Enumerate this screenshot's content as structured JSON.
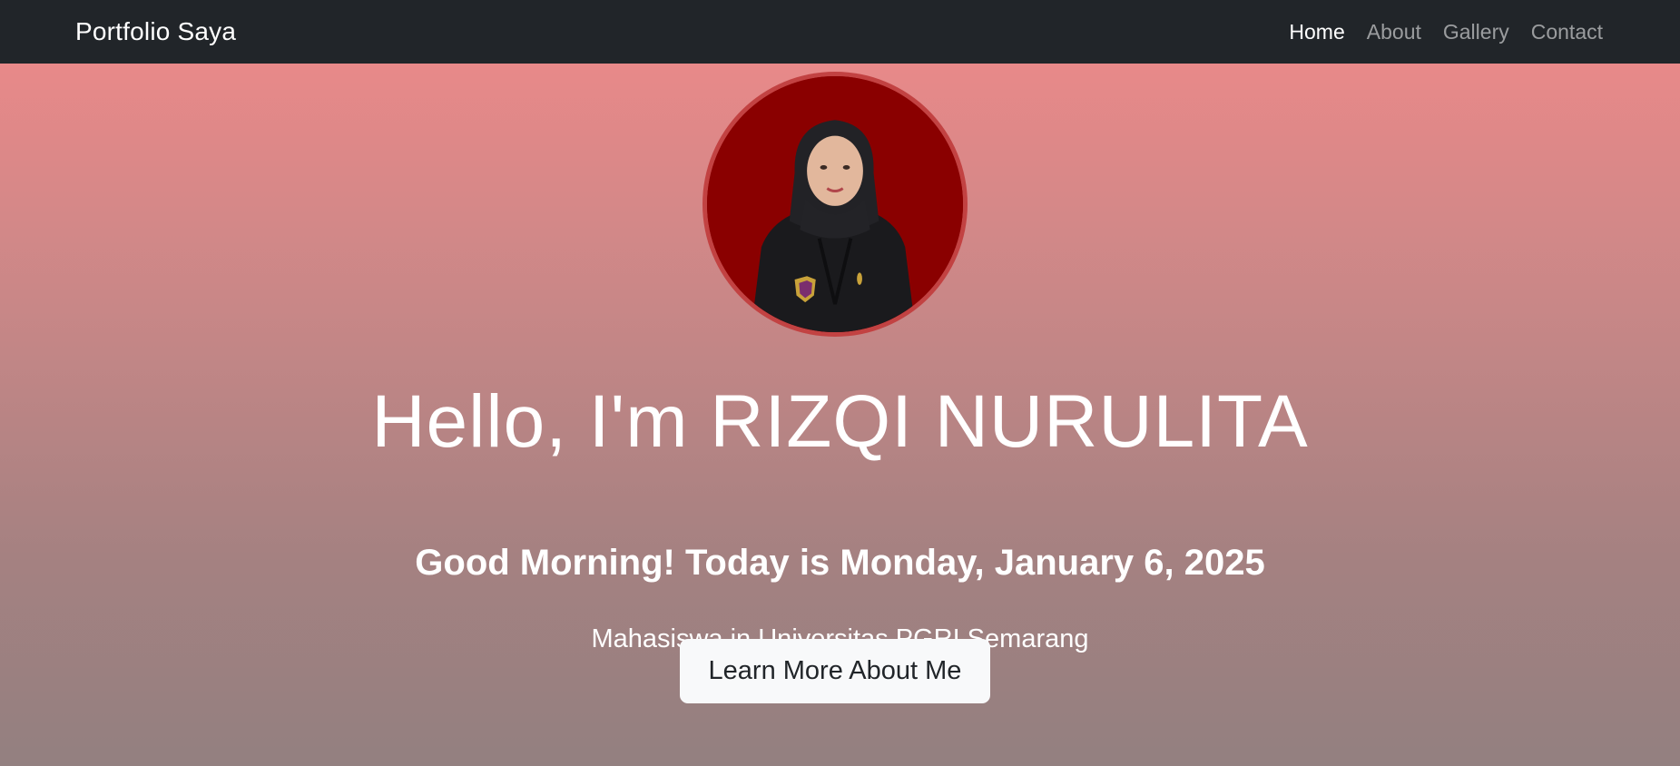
{
  "navbar": {
    "brand": "Portfolio Saya",
    "links": [
      {
        "label": "Home",
        "active": true
      },
      {
        "label": "About",
        "active": false
      },
      {
        "label": "Gallery",
        "active": false
      },
      {
        "label": "Contact",
        "active": false
      }
    ]
  },
  "hero": {
    "title": "Hello, I'm RIZQI NURULITA",
    "greeting": "Good Morning! Today is Monday, January 6, 2025",
    "subtitle": "Mahasiswa in Universitas PGRI Semarang",
    "cta_label": "Learn More About Me"
  },
  "colors": {
    "navbar_bg": "#212529",
    "gradient_top": "#e88989",
    "gradient_bottom": "#938080",
    "avatar_bg": "#8a0000",
    "button_bg": "#f8f9fa"
  }
}
